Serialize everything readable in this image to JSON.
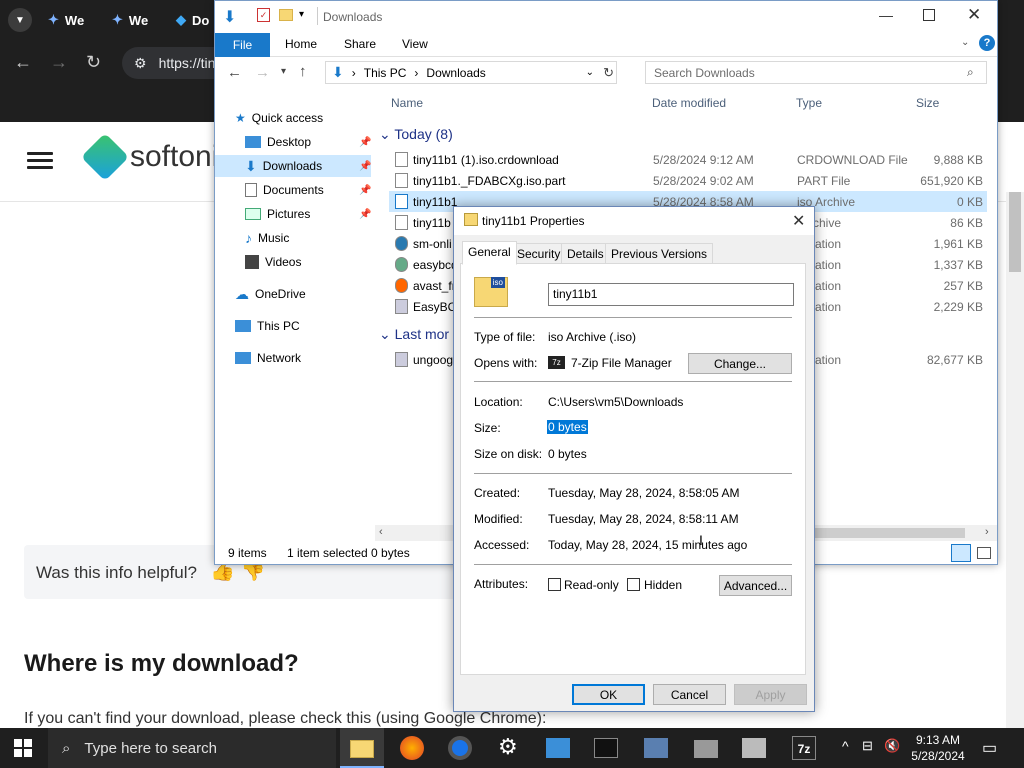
{
  "chrome": {
    "tabs": [
      {
        "label": "We"
      },
      {
        "label": "We"
      },
      {
        "label": "Do"
      }
    ],
    "url": "https://tin"
  },
  "site": {
    "logo": "softoni",
    "helpful": "Was this info helpful?",
    "where_heading": "Where is my download?",
    "where_text": "If you can't find your download, please check this (using Google Chrome):"
  },
  "explorer": {
    "title": "Downloads",
    "ribbon": {
      "file": "File",
      "home": "Home",
      "share": "Share",
      "view": "View"
    },
    "address": {
      "thispc": "This PC",
      "folder": "Downloads"
    },
    "search_placeholder": "Search Downloads",
    "nav": [
      {
        "label": "Quick access"
      },
      {
        "label": "Desktop"
      },
      {
        "label": "Downloads"
      },
      {
        "label": "Documents"
      },
      {
        "label": "Pictures"
      },
      {
        "label": "Music"
      },
      {
        "label": "Videos"
      },
      {
        "label": "OneDrive"
      },
      {
        "label": "This PC"
      },
      {
        "label": "Network"
      }
    ],
    "columns": {
      "name": "Name",
      "date": "Date modified",
      "type": "Type",
      "size": "Size"
    },
    "group_today": "Today (8)",
    "group_last": "Last mor",
    "files": [
      {
        "name": "tiny11b1 (1).iso.crdownload",
        "date": "5/28/2024 9:12 AM",
        "type": "CRDOWNLOAD File",
        "size": "9,888 KB"
      },
      {
        "name": "tiny11b1._FDABCXg.iso.part",
        "date": "5/28/2024 9:02 AM",
        "type": "PART File",
        "size": "651,920 KB"
      },
      {
        "name": "tiny11b1",
        "date": "5/28/2024 8:58 AM",
        "type": "iso Archive",
        "size": "0 KB"
      },
      {
        "name": "tiny11b",
        "date": "",
        "type": "Archive",
        "size": "86 KB"
      },
      {
        "name": "sm-onli",
        "date": "",
        "type": "plication",
        "size": "1,961 KB"
      },
      {
        "name": "easybcd",
        "date": "",
        "type": "plication",
        "size": "1,337 KB"
      },
      {
        "name": "avast_fr",
        "date": "",
        "type": "plication",
        "size": "257 KB"
      },
      {
        "name": "EasyBC",
        "date": "",
        "type": "plication",
        "size": "2,229 KB"
      },
      {
        "name": "ungoog",
        "date": "",
        "type": "plication",
        "size": "82,677 KB"
      }
    ],
    "status_items": "9 items",
    "status_selected": "1 item selected  0 bytes"
  },
  "props": {
    "title": "tiny11b1 Properties",
    "tabs": [
      "General",
      "Security",
      "Details",
      "Previous Versions"
    ],
    "name_value": "tiny11b1",
    "type_label": "Type of file:",
    "type_value": "iso Archive (.iso)",
    "opens_label": "Opens with:",
    "opens_value": "7-Zip File Manager",
    "change": "Change...",
    "location_label": "Location:",
    "location_value": "C:\\Users\\vm5\\Downloads",
    "size_label": "Size:",
    "size_value": "0 bytes",
    "sizedisk_label": "Size on disk:",
    "sizedisk_value": "0 bytes",
    "created_label": "Created:",
    "created_value": "Tuesday, May 28, 2024, 8:58:05 AM",
    "modified_label": "Modified:",
    "modified_value": "Tuesday, May 28, 2024, 8:58:11 AM",
    "accessed_label": "Accessed:",
    "accessed_value": "Today, May 28, 2024, 15 minutes ago",
    "attributes_label": "Attributes:",
    "readonly": "Read-only",
    "hidden": "Hidden",
    "advanced": "Advanced...",
    "ok": "OK",
    "cancel": "Cancel",
    "apply": "Apply"
  },
  "taskbar": {
    "search": "Type here to search",
    "time": "9:13 AM",
    "date": "5/28/2024"
  },
  "colors": {
    "accent": "#1979ca",
    "selection": "#cce8ff",
    "taskbar": "#1f1f1f"
  }
}
